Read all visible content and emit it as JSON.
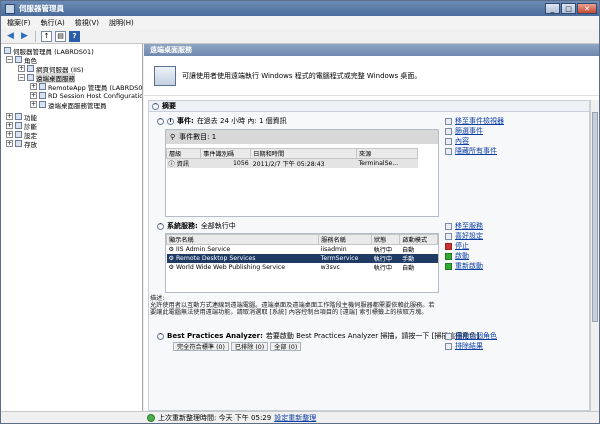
{
  "window": {
    "title": "伺服器管理員"
  },
  "menu": [
    "檔案(F)",
    "執行(A)",
    "檢視(V)",
    "說明(H)"
  ],
  "tree": [
    {
      "label": "伺服器管理員 (LABRDS01)",
      "level": 0,
      "expander": ""
    },
    {
      "label": "角色",
      "level": 1,
      "expander": "−"
    },
    {
      "label": "網頁伺服器 (IIS)",
      "level": 2,
      "expander": "+"
    },
    {
      "label": "遠端桌面服務",
      "level": 2,
      "expander": "−",
      "selected": true
    },
    {
      "label": "RemoteApp 管理員 (LABRDS0",
      "level": 3,
      "expander": "+"
    },
    {
      "label": "RD Session Host Configuration:",
      "level": 3,
      "expander": "+"
    },
    {
      "label": "遠端桌面服務管理員",
      "level": 3,
      "expander": "+"
    },
    {
      "label": "功能",
      "level": 1,
      "expander": "+"
    },
    {
      "label": "診斷",
      "level": 1,
      "expander": "+"
    },
    {
      "label": "設定",
      "level": 1,
      "expander": "+"
    },
    {
      "label": "存放",
      "level": 1,
      "expander": "+"
    }
  ],
  "main": {
    "header": "遠端桌面服務",
    "banner_text": "可讓使用者使用遠端執行 Windows 程式的電腦程式或完整 Windows 桌面。",
    "summary_title": "摘要",
    "events": {
      "title": "事件:",
      "subtitle": "在過去 24 小時 內: 1 個資訊",
      "filter_label": "事件數目: 1",
      "columns": [
        "層級",
        "事件識別碼",
        "日期和時間",
        "來源"
      ],
      "rows": [
        [
          "資訊",
          "1056",
          "2011/2/7 下午 05:28:43",
          "TerminalSe..."
        ]
      ]
    },
    "event_actions": [
      "移至事件檢視器",
      "篩選事件",
      "內容",
      "隱藏所有事件"
    ],
    "services": {
      "title": "系統服務:",
      "subtitle": "全部執行中",
      "columns": [
        "顯示名稱",
        "服務名稱",
        "狀態",
        "啟動模式"
      ],
      "rows": [
        [
          "IIS Admin Service",
          "iisadmin",
          "執行中",
          "自動"
        ],
        [
          "Remote Desktop Services",
          "TermService",
          "執行中",
          "手動"
        ],
        [
          "World Wide Web Publishing Service",
          "w3svc",
          "執行中",
          "自動"
        ]
      ],
      "selected_row": 1
    },
    "service_actions": [
      "移至服務",
      "喜好設定",
      "停止",
      "啟動",
      "重新啟動"
    ],
    "desc_label": "描述:",
    "desc_text": "允許使用者以互動方式連線到遠端電腦。遠端桌面及遠端桌面工作階段主機伺服器都需要依賴此服務。若要讓此電腦無法使用遠端功能，請取消選取 [系統] 內容控制台項目的 [遠端] 索引標籤上的核取方塊。",
    "bpa": {
      "title": "Best Practices Analyzer:",
      "subtitle": "若要啟動 Best Practices Analyzer 掃描，請按一下 [掃描這個角色]",
      "tabs": [
        "完全符合標準 (0)",
        "已排除 (0)",
        "全部 (0)"
      ]
    },
    "bpa_actions": [
      "掃描這個角色",
      "排除結果"
    ]
  },
  "status": {
    "text": "上次重新整理時間: 今天 下午 05:29",
    "link": "設定重新整理"
  }
}
